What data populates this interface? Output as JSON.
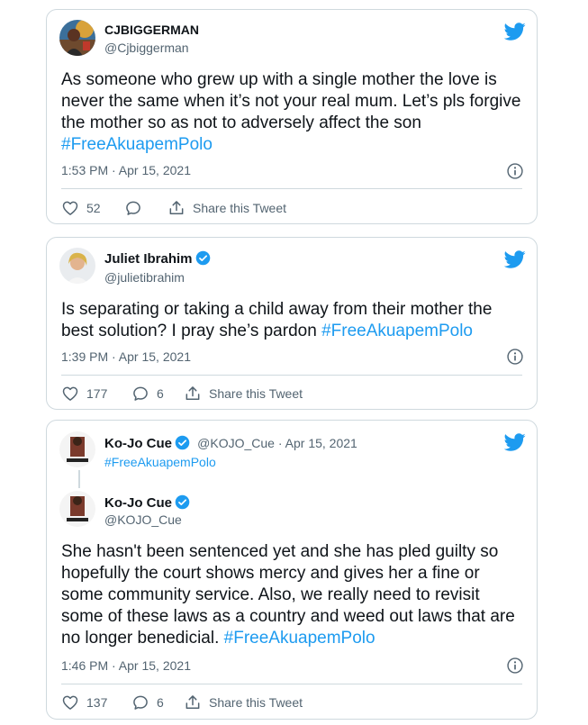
{
  "tweets": [
    {
      "name": "CJBIGGERMAN",
      "handle": "@Cjbiggerman",
      "text": "As someone who grew up with a single mother the love is never the same when it’s not your real mum. Let’s  pls forgive the mother so as not to adversely affect the son ",
      "hashtag": "#FreeAkuapemPolo",
      "timestamp": "1:53 PM · Apr 15, 2021",
      "likes": "52",
      "replies": "",
      "share_label": "Share this Tweet"
    },
    {
      "name": "Juliet Ibrahim",
      "handle": "@julietibrahim",
      "text": "Is separating or taking a child away from their mother the best solution? I pray she’s pardon ",
      "hashtag": "#FreeAkuapemPolo",
      "timestamp": "1:39 PM · Apr 15, 2021",
      "likes": "177",
      "replies": "6",
      "share_label": "Share this Tweet"
    },
    {
      "parent": {
        "name": "Ko-Jo Cue",
        "meta": "@KOJO_Cue · Apr 15, 2021",
        "hashtag": "#FreeAkuapemPolo"
      },
      "name": "Ko-Jo Cue",
      "handle": "@KOJO_Cue",
      "text": "She hasn't been sentenced yet and she has pled guilty so hopefully the court shows mercy and gives her a fine or some community service. Also, we really need to revisit some of these laws as a country and weed out laws that are no longer benedicial. ",
      "hashtag": "#FreeAkuapemPolo",
      "timestamp": "1:46 PM · Apr 15, 2021",
      "likes": "137",
      "replies": "6",
      "share_label": "Share this Tweet"
    }
  ],
  "colors": {
    "brand": "#1d9bf0",
    "muted": "#536471",
    "border": "#cfd9de"
  },
  "icons": [
    "twitter-bird-icon",
    "verified-badge-icon",
    "info-icon",
    "heart-icon",
    "reply-icon",
    "share-icon"
  ]
}
